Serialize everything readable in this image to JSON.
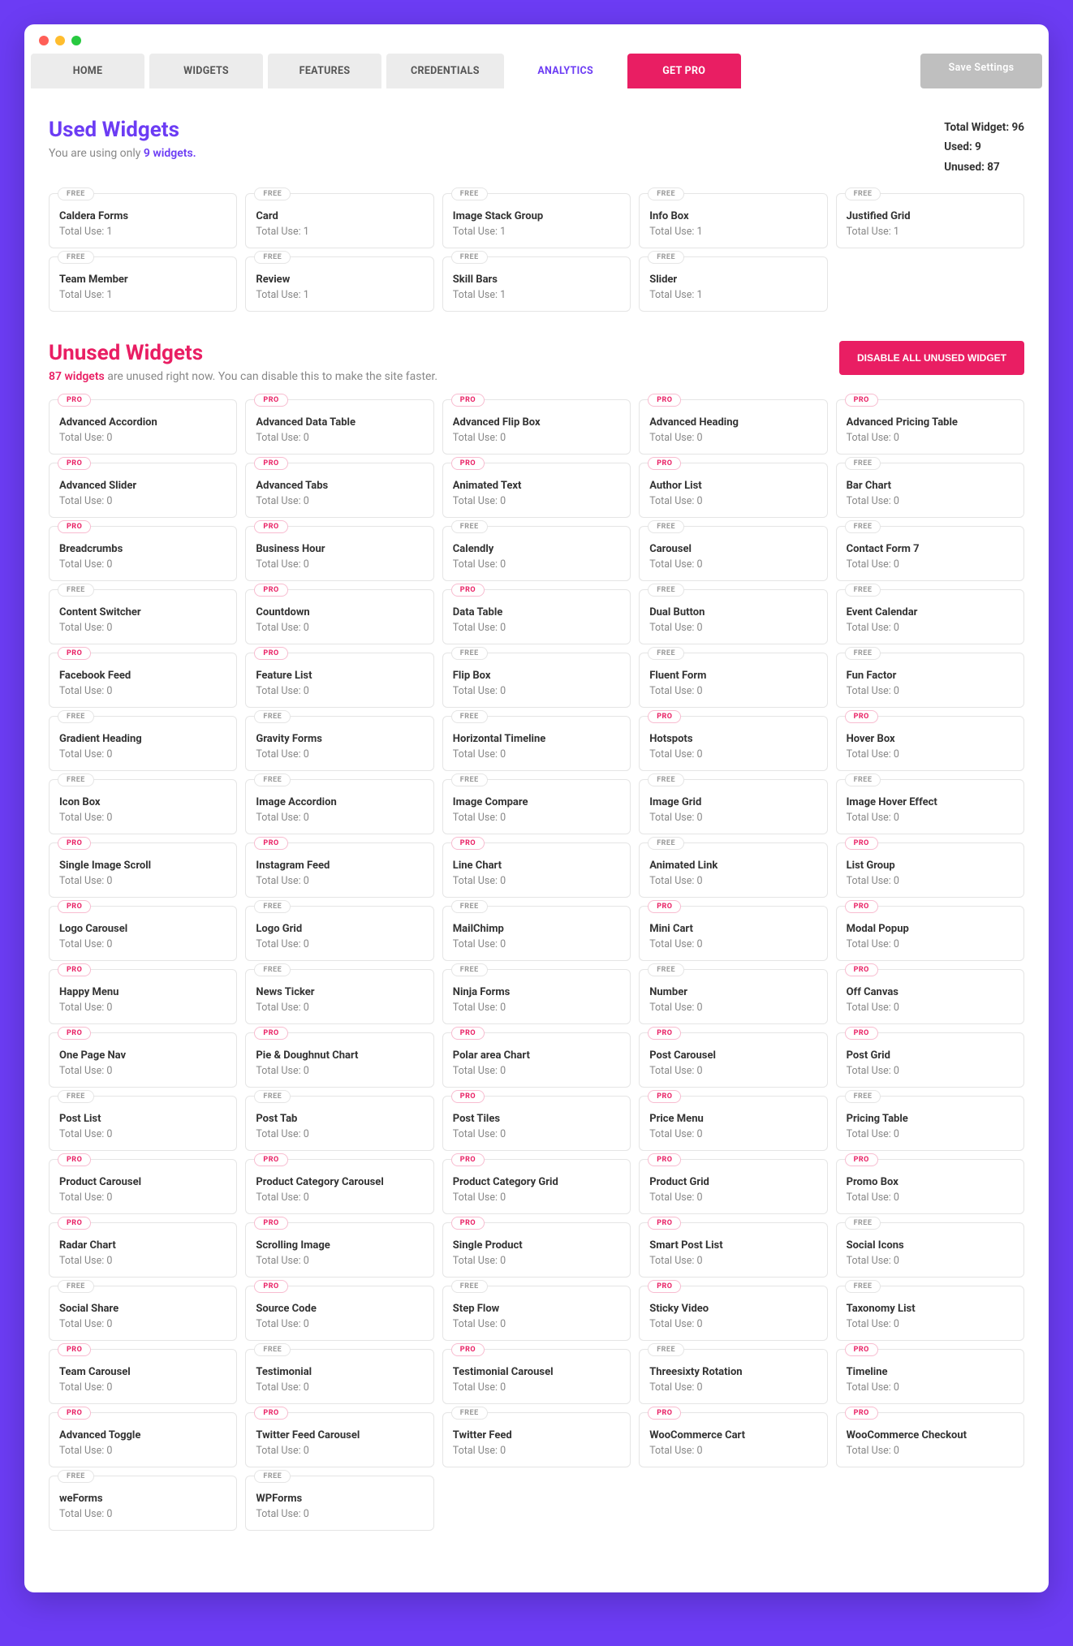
{
  "tabs": [
    "HOME",
    "WIDGETS",
    "FEATURES",
    "CREDENTIALS",
    "ANALYTICS"
  ],
  "pro_tab": "GET PRO",
  "save_tab": "Save Settings",
  "active_tab": "ANALYTICS",
  "used_heading": "Used Widgets",
  "used_sub_prefix": "You are using only ",
  "used_sub_hl": "9 widgets.",
  "stats": {
    "total": "Total Widget: 96",
    "used": "Used: 9",
    "unused": "Unused: 87"
  },
  "used_widgets": [
    {
      "name": "Caldera Forms",
      "use": "Total Use: 1",
      "badge": "FREE"
    },
    {
      "name": "Card",
      "use": "Total Use: 1",
      "badge": "FREE"
    },
    {
      "name": "Image Stack Group",
      "use": "Total Use: 1",
      "badge": "FREE"
    },
    {
      "name": "Info Box",
      "use": "Total Use: 1",
      "badge": "FREE"
    },
    {
      "name": "Justified Grid",
      "use": "Total Use: 1",
      "badge": "FREE"
    },
    {
      "name": "Team Member",
      "use": "Total Use: 1",
      "badge": "FREE"
    },
    {
      "name": "Review",
      "use": "Total Use: 1",
      "badge": "FREE"
    },
    {
      "name": "Skill Bars",
      "use": "Total Use: 1",
      "badge": "FREE"
    },
    {
      "name": "Slider",
      "use": "Total Use: 1",
      "badge": "FREE"
    }
  ],
  "unused_heading": "Unused Widgets",
  "unused_sub_hl": "87 widgets",
  "unused_sub_rest": " are unused right now. You can disable this to make the site faster.",
  "disable_btn": "DISABLE ALL UNUSED WIDGET",
  "unused_widgets": [
    {
      "name": "Advanced Accordion",
      "use": "Total Use: 0",
      "badge": "PRO"
    },
    {
      "name": "Advanced Data Table",
      "use": "Total Use: 0",
      "badge": "PRO"
    },
    {
      "name": "Advanced Flip Box",
      "use": "Total Use: 0",
      "badge": "PRO"
    },
    {
      "name": "Advanced Heading",
      "use": "Total Use: 0",
      "badge": "PRO"
    },
    {
      "name": "Advanced Pricing Table",
      "use": "Total Use: 0",
      "badge": "PRO"
    },
    {
      "name": "Advanced Slider",
      "use": "Total Use: 0",
      "badge": "PRO"
    },
    {
      "name": "Advanced Tabs",
      "use": "Total Use: 0",
      "badge": "PRO"
    },
    {
      "name": "Animated Text",
      "use": "Total Use: 0",
      "badge": "PRO"
    },
    {
      "name": "Author List",
      "use": "Total Use: 0",
      "badge": "PRO"
    },
    {
      "name": "Bar Chart",
      "use": "Total Use: 0",
      "badge": "FREE"
    },
    {
      "name": "Breadcrumbs",
      "use": "Total Use: 0",
      "badge": "PRO"
    },
    {
      "name": "Business Hour",
      "use": "Total Use: 0",
      "badge": "PRO"
    },
    {
      "name": "Calendly",
      "use": "Total Use: 0",
      "badge": "FREE"
    },
    {
      "name": "Carousel",
      "use": "Total Use: 0",
      "badge": "FREE"
    },
    {
      "name": "Contact Form 7",
      "use": "Total Use: 0",
      "badge": "FREE"
    },
    {
      "name": "Content Switcher",
      "use": "Total Use: 0",
      "badge": "FREE"
    },
    {
      "name": "Countdown",
      "use": "Total Use: 0",
      "badge": "PRO"
    },
    {
      "name": "Data Table",
      "use": "Total Use: 0",
      "badge": "PRO"
    },
    {
      "name": "Dual Button",
      "use": "Total Use: 0",
      "badge": "FREE"
    },
    {
      "name": "Event Calendar",
      "use": "Total Use: 0",
      "badge": "FREE"
    },
    {
      "name": "Facebook Feed",
      "use": "Total Use: 0",
      "badge": "PRO"
    },
    {
      "name": "Feature List",
      "use": "Total Use: 0",
      "badge": "PRO"
    },
    {
      "name": "Flip Box",
      "use": "Total Use: 0",
      "badge": "FREE"
    },
    {
      "name": "Fluent Form",
      "use": "Total Use: 0",
      "badge": "FREE"
    },
    {
      "name": "Fun Factor",
      "use": "Total Use: 0",
      "badge": "FREE"
    },
    {
      "name": "Gradient Heading",
      "use": "Total Use: 0",
      "badge": "FREE"
    },
    {
      "name": "Gravity Forms",
      "use": "Total Use: 0",
      "badge": "FREE"
    },
    {
      "name": "Horizontal Timeline",
      "use": "Total Use: 0",
      "badge": "FREE"
    },
    {
      "name": "Hotspots",
      "use": "Total Use: 0",
      "badge": "PRO"
    },
    {
      "name": "Hover Box",
      "use": "Total Use: 0",
      "badge": "PRO"
    },
    {
      "name": "Icon Box",
      "use": "Total Use: 0",
      "badge": "FREE"
    },
    {
      "name": "Image Accordion",
      "use": "Total Use: 0",
      "badge": "FREE"
    },
    {
      "name": "Image Compare",
      "use": "Total Use: 0",
      "badge": "FREE"
    },
    {
      "name": "Image Grid",
      "use": "Total Use: 0",
      "badge": "FREE"
    },
    {
      "name": "Image Hover Effect",
      "use": "Total Use: 0",
      "badge": "FREE"
    },
    {
      "name": "Single Image Scroll",
      "use": "Total Use: 0",
      "badge": "PRO"
    },
    {
      "name": "Instagram Feed",
      "use": "Total Use: 0",
      "badge": "PRO"
    },
    {
      "name": "Line Chart",
      "use": "Total Use: 0",
      "badge": "PRO"
    },
    {
      "name": "Animated Link",
      "use": "Total Use: 0",
      "badge": "FREE"
    },
    {
      "name": "List Group",
      "use": "Total Use: 0",
      "badge": "PRO"
    },
    {
      "name": "Logo Carousel",
      "use": "Total Use: 0",
      "badge": "PRO"
    },
    {
      "name": "Logo Grid",
      "use": "Total Use: 0",
      "badge": "FREE"
    },
    {
      "name": "MailChimp",
      "use": "Total Use: 0",
      "badge": "FREE"
    },
    {
      "name": "Mini Cart",
      "use": "Total Use: 0",
      "badge": "PRO"
    },
    {
      "name": "Modal Popup",
      "use": "Total Use: 0",
      "badge": "PRO"
    },
    {
      "name": "Happy Menu",
      "use": "Total Use: 0",
      "badge": "PRO"
    },
    {
      "name": "News Ticker",
      "use": "Total Use: 0",
      "badge": "FREE"
    },
    {
      "name": "Ninja Forms",
      "use": "Total Use: 0",
      "badge": "FREE"
    },
    {
      "name": "Number",
      "use": "Total Use: 0",
      "badge": "FREE"
    },
    {
      "name": "Off Canvas",
      "use": "Total Use: 0",
      "badge": "PRO"
    },
    {
      "name": "One Page Nav",
      "use": "Total Use: 0",
      "badge": "PRO"
    },
    {
      "name": "Pie & Doughnut Chart",
      "use": "Total Use: 0",
      "badge": "PRO"
    },
    {
      "name": "Polar area Chart",
      "use": "Total Use: 0",
      "badge": "PRO"
    },
    {
      "name": "Post Carousel",
      "use": "Total Use: 0",
      "badge": "PRO"
    },
    {
      "name": "Post Grid",
      "use": "Total Use: 0",
      "badge": "PRO"
    },
    {
      "name": "Post List",
      "use": "Total Use: 0",
      "badge": "FREE"
    },
    {
      "name": "Post Tab",
      "use": "Total Use: 0",
      "badge": "FREE"
    },
    {
      "name": "Post Tiles",
      "use": "Total Use: 0",
      "badge": "PRO"
    },
    {
      "name": "Price Menu",
      "use": "Total Use: 0",
      "badge": "PRO"
    },
    {
      "name": "Pricing Table",
      "use": "Total Use: 0",
      "badge": "FREE"
    },
    {
      "name": "Product Carousel",
      "use": "Total Use: 0",
      "badge": "PRO"
    },
    {
      "name": "Product Category Carousel",
      "use": "Total Use: 0",
      "badge": "PRO"
    },
    {
      "name": "Product Category Grid",
      "use": "Total Use: 0",
      "badge": "PRO"
    },
    {
      "name": "Product Grid",
      "use": "Total Use: 0",
      "badge": "PRO"
    },
    {
      "name": "Promo Box",
      "use": "Total Use: 0",
      "badge": "PRO"
    },
    {
      "name": "Radar Chart",
      "use": "Total Use: 0",
      "badge": "PRO"
    },
    {
      "name": "Scrolling Image",
      "use": "Total Use: 0",
      "badge": "PRO"
    },
    {
      "name": "Single Product",
      "use": "Total Use: 0",
      "badge": "PRO"
    },
    {
      "name": "Smart Post List",
      "use": "Total Use: 0",
      "badge": "PRO"
    },
    {
      "name": "Social Icons",
      "use": "Total Use: 0",
      "badge": "FREE"
    },
    {
      "name": "Social Share",
      "use": "Total Use: 0",
      "badge": "FREE"
    },
    {
      "name": "Source Code",
      "use": "Total Use: 0",
      "badge": "PRO"
    },
    {
      "name": "Step Flow",
      "use": "Total Use: 0",
      "badge": "FREE"
    },
    {
      "name": "Sticky Video",
      "use": "Total Use: 0",
      "badge": "PRO"
    },
    {
      "name": "Taxonomy List",
      "use": "Total Use: 0",
      "badge": "FREE"
    },
    {
      "name": "Team Carousel",
      "use": "Total Use: 0",
      "badge": "PRO"
    },
    {
      "name": "Testimonial",
      "use": "Total Use: 0",
      "badge": "FREE"
    },
    {
      "name": "Testimonial Carousel",
      "use": "Total Use: 0",
      "badge": "PRO"
    },
    {
      "name": "Threesixty Rotation",
      "use": "Total Use: 0",
      "badge": "FREE"
    },
    {
      "name": "Timeline",
      "use": "Total Use: 0",
      "badge": "PRO"
    },
    {
      "name": "Advanced Toggle",
      "use": "Total Use: 0",
      "badge": "PRO"
    },
    {
      "name": "Twitter Feed Carousel",
      "use": "Total Use: 0",
      "badge": "PRO"
    },
    {
      "name": "Twitter Feed",
      "use": "Total Use: 0",
      "badge": "FREE"
    },
    {
      "name": "WooCommerce Cart",
      "use": "Total Use: 0",
      "badge": "PRO"
    },
    {
      "name": "WooCommerce Checkout",
      "use": "Total Use: 0",
      "badge": "PRO"
    },
    {
      "name": "weForms",
      "use": "Total Use: 0",
      "badge": "FREE"
    },
    {
      "name": "WPForms",
      "use": "Total Use: 0",
      "badge": "FREE"
    }
  ]
}
